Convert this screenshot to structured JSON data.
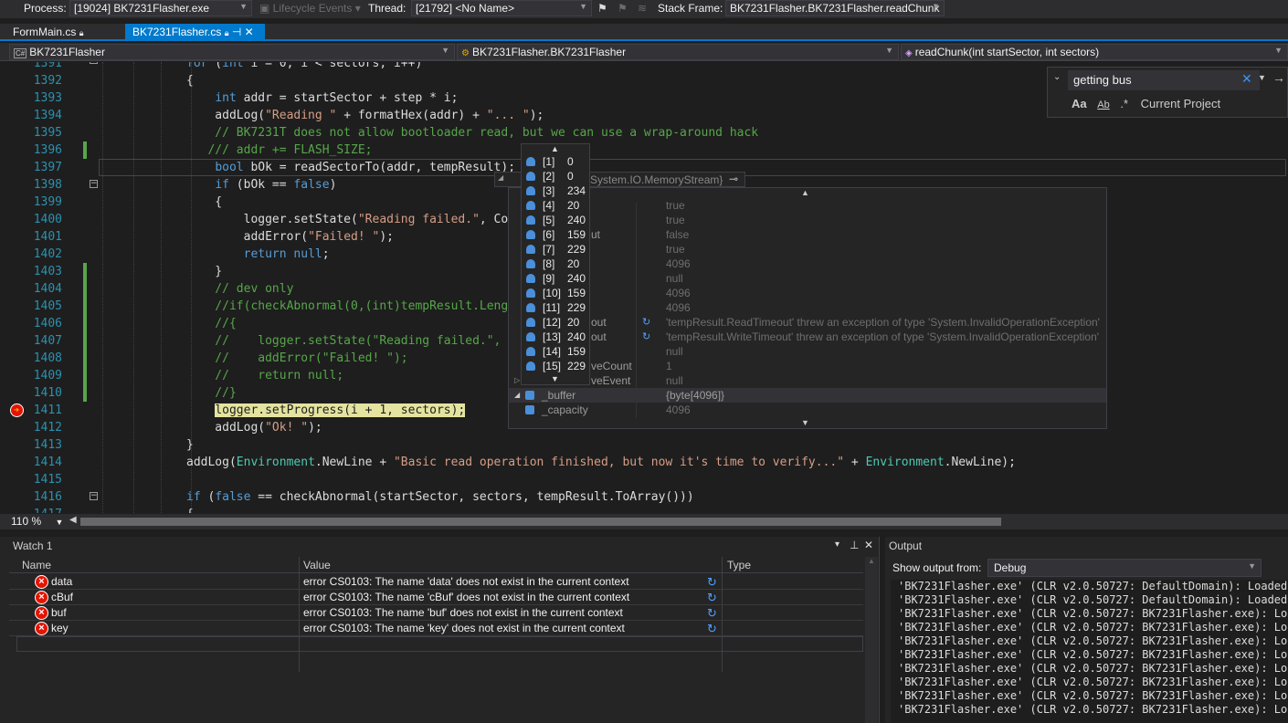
{
  "debugbar": {
    "process_label": "Process:",
    "process_value": "[19024] BK7231Flasher.exe",
    "lifecycle": "Lifecycle Events",
    "thread_label": "Thread:",
    "thread_value": "[21792] <No Name>",
    "stackframe_label": "Stack Frame:",
    "stackframe_value": "BK7231Flasher.BK7231Flasher.readChunk"
  },
  "tabs": [
    {
      "label": "FormMain.cs"
    },
    {
      "label": "BK7231Flasher.cs"
    }
  ],
  "nav": {
    "project": "BK7231Flasher",
    "class": "BK7231Flasher.BK7231Flasher",
    "method": "readChunk(int startSector, int sectors)"
  },
  "editor": {
    "lines": [
      {
        "n": "1391",
        "code": "for (int i = 0; i < sectors; i++)"
      },
      {
        "n": "1392",
        "code": "{"
      },
      {
        "n": "1393",
        "code": "    int addr = startSector + step * i;"
      },
      {
        "n": "1394",
        "code": "    addLog(\"Reading \" + formatHex(addr) + \"... \");"
      },
      {
        "n": "1395",
        "code": "    // BK7231T does not allow bootloader read, but we can use a wrap-around hack"
      },
      {
        "n": "1396",
        "code": "   /// addr += FLASH_SIZE;"
      },
      {
        "n": "1397",
        "code": "    bool bOk = readSectorTo(addr, tempResult);"
      },
      {
        "n": "1398",
        "code": "    if (bOk == false)"
      },
      {
        "n": "1399",
        "code": "    {"
      },
      {
        "n": "1400",
        "code": "        logger.setState(\"Reading failed.\", Co"
      },
      {
        "n": "1401",
        "code": "        addError(\"Failed! \");"
      },
      {
        "n": "1402",
        "code": "        return null;"
      },
      {
        "n": "1403",
        "code": "    }"
      },
      {
        "n": "1404",
        "code": "    // dev only"
      },
      {
        "n": "1405",
        "code": "    //if(checkAbnormal(0,(int)tempResult.Leng"
      },
      {
        "n": "1406",
        "code": "    //{"
      },
      {
        "n": "1407",
        "code": "    //    logger.setState(\"Reading failed.\","
      },
      {
        "n": "1408",
        "code": "    //    addError(\"Failed! \");"
      },
      {
        "n": "1409",
        "code": "    //    return null;"
      },
      {
        "n": "1410",
        "code": "    //}"
      },
      {
        "n": "1411",
        "code": "    logger.setProgress(i + 1, sectors);"
      },
      {
        "n": "1412",
        "code": "    addLog(\"Ok! \");"
      },
      {
        "n": "1413",
        "code": "}"
      },
      {
        "n": "1414",
        "code": "addLog(Environment.NewLine + \"Basic read operation finished, but now it's time to verify...\" + Environment.NewLine);"
      },
      {
        "n": "1415",
        "code": ""
      },
      {
        "n": "1416",
        "code": "if (false == checkAbnormal(startSector, sectors, tempResult.ToArray()))"
      },
      {
        "n": "1417",
        "code": "{"
      }
    ]
  },
  "datatip": {
    "header_type": "System.IO.MemoryStream}",
    "rows": [
      {
        "name": "",
        "value": "true"
      },
      {
        "name": "",
        "value": "true"
      },
      {
        "name": "ut",
        "value": "false"
      },
      {
        "name": "",
        "value": "true"
      },
      {
        "name": "",
        "value": "4096"
      },
      {
        "name": "",
        "value": "null"
      },
      {
        "name": "",
        "value": "4096"
      },
      {
        "name": "",
        "value": "4096"
      },
      {
        "name": "out",
        "value": "'tempResult.ReadTimeout' threw an exception of type 'System.InvalidOperationException'"
      },
      {
        "name": "out",
        "value": "'tempResult.WriteTimeout' threw an exception of type 'System.InvalidOperationException'"
      },
      {
        "name": "",
        "value": "null"
      },
      {
        "name": "veCount",
        "value": "1"
      },
      {
        "name": "veEvent",
        "value": "null"
      },
      {
        "name": "_buffer",
        "value": "{byte[4096]}"
      },
      {
        "name": "_capacity",
        "value": "4096"
      }
    ]
  },
  "array_popup": {
    "items": [
      {
        "idx": "[1]",
        "val": "0"
      },
      {
        "idx": "[2]",
        "val": "0"
      },
      {
        "idx": "[3]",
        "val": "234"
      },
      {
        "idx": "[4]",
        "val": "20"
      },
      {
        "idx": "[5]",
        "val": "240"
      },
      {
        "idx": "[6]",
        "val": "159"
      },
      {
        "idx": "[7]",
        "val": "229"
      },
      {
        "idx": "[8]",
        "val": "20"
      },
      {
        "idx": "[9]",
        "val": "240"
      },
      {
        "idx": "[10]",
        "val": "159"
      },
      {
        "idx": "[11]",
        "val": "229"
      },
      {
        "idx": "[12]",
        "val": "20"
      },
      {
        "idx": "[13]",
        "val": "240"
      },
      {
        "idx": "[14]",
        "val": "159"
      },
      {
        "idx": "[15]",
        "val": "229"
      }
    ]
  },
  "search": {
    "query": "getting bus",
    "scope": "Current Project",
    "opt_case": "Aa",
    "opt_word": "Ab",
    "opt_regex": ".*"
  },
  "zoom": "110 %",
  "watch": {
    "title": "Watch 1",
    "col_name": "Name",
    "col_value": "Value",
    "col_type": "Type",
    "rows": [
      {
        "name": "data",
        "value": "error CS0103: The name 'data' does not exist in the current context"
      },
      {
        "name": "cBuf",
        "value": "error CS0103: The name 'cBuf' does not exist in the current context"
      },
      {
        "name": "buf",
        "value": "error CS0103: The name 'buf' does not exist in the current context"
      },
      {
        "name": "key",
        "value": "error CS0103: The name 'key' does not exist in the current context"
      }
    ]
  },
  "output": {
    "title": "Output",
    "from_label": "Show output from:",
    "from_value": "Debug",
    "lines": [
      "'BK7231Flasher.exe' (CLR v2.0.50727: DefaultDomain): Loaded '",
      "'BK7231Flasher.exe' (CLR v2.0.50727: DefaultDomain): Loaded '",
      "'BK7231Flasher.exe' (CLR v2.0.50727: BK7231Flasher.exe): Load",
      "'BK7231Flasher.exe' (CLR v2.0.50727: BK7231Flasher.exe): Load",
      "'BK7231Flasher.exe' (CLR v2.0.50727: BK7231Flasher.exe): Load",
      "'BK7231Flasher.exe' (CLR v2.0.50727: BK7231Flasher.exe): Load",
      "'BK7231Flasher.exe' (CLR v2.0.50727: BK7231Flasher.exe): Load",
      "'BK7231Flasher.exe' (CLR v2.0.50727: BK7231Flasher.exe): Load",
      "'BK7231Flasher.exe' (CLR v2.0.50727: BK7231Flasher.exe): Load",
      "'BK7231Flasher.exe' (CLR v2.0.50727: BK7231Flasher.exe): Load"
    ]
  }
}
